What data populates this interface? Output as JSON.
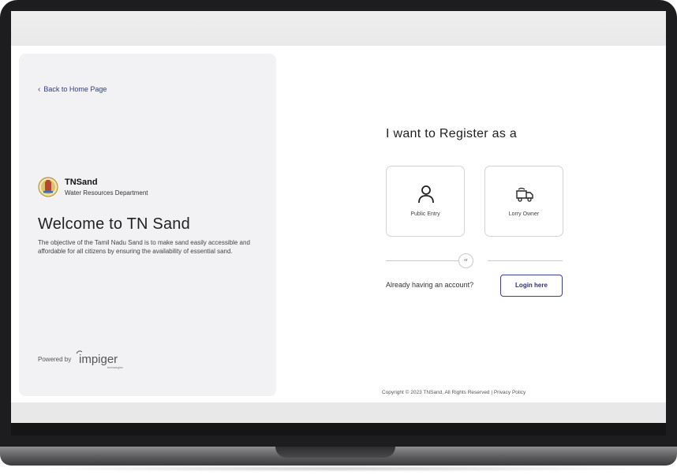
{
  "left": {
    "back_link": "Back to Home Page",
    "brand_name": "TNSand",
    "brand_subtitle": "Water Resources Department",
    "welcome_title": "Welcome to TN Sand",
    "welcome_text": "The objective of the Tamil Nadu Sand is to make sand easily accessible and affordable for all citizens by ensuring the availability of essential sand.",
    "powered_by": "Powered by",
    "powered_logo_text": "impiger",
    "powered_logo_sub": "technologies"
  },
  "register": {
    "heading": "I want to Register as a",
    "options": [
      {
        "label": "Public Entry",
        "icon": "person-icon"
      },
      {
        "label": "Lorry Owner",
        "icon": "truck-icon"
      }
    ],
    "or_label": "or",
    "already_text": "Already having an account?",
    "login_label": "Login here"
  },
  "footer": {
    "copyright": "Copyright © 2023 TNSand, All Rights Reserved | Privacy Policy"
  },
  "colors": {
    "accent": "#2e3270",
    "panel_bg": "#f2f2f4",
    "frame": "#1d1d1f"
  }
}
